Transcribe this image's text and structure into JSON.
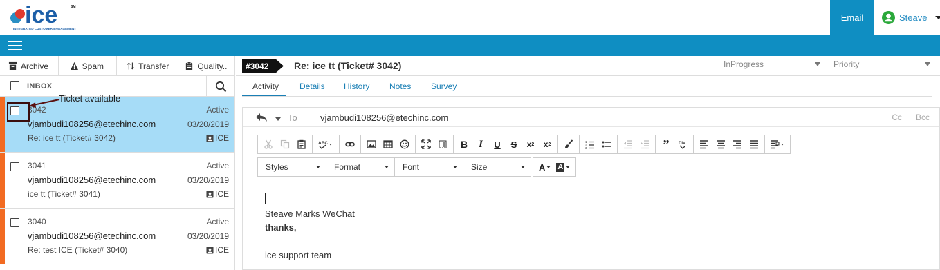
{
  "header": {
    "logo_text": "ice",
    "logo_sm": "SM",
    "logo_tagline": "INTEGRATED CUSTOMER ENGAGEMENT",
    "email_tab": "Email",
    "user_name": "Steave"
  },
  "colors": {
    "brand_blue": "#0f8ec2",
    "selected_row": "#a6dcf7",
    "priority_stripe": "#f26b22"
  },
  "actions": [
    {
      "label": "Archive",
      "icon": "archive-icon"
    },
    {
      "label": "Spam",
      "icon": "warning-icon"
    },
    {
      "label": "Transfer",
      "icon": "transfer-icon"
    },
    {
      "label": "Quality..",
      "icon": "clipboard-icon"
    }
  ],
  "inbox": {
    "label": "INBOX"
  },
  "tickets": [
    {
      "id": "3042",
      "status": "Active",
      "email": "vjambudi108256@etechinc.com",
      "date": "03/20/2019",
      "subject": "Re: ice tt (Ticket# 3042)",
      "source": "ICE"
    },
    {
      "id": "3041",
      "status": "Active",
      "email": "vjambudi108256@etechinc.com",
      "date": "03/20/2019",
      "subject": "ice tt (Ticket# 3041)",
      "source": "ICE"
    },
    {
      "id": "3040",
      "status": "Active",
      "email": "vjambudi108256@etechinc.com",
      "date": "03/20/2019",
      "subject": "Re: test ICE (Ticket# 3040)",
      "source": "ICE"
    }
  ],
  "annotation": {
    "text": "Ticket available"
  },
  "detail": {
    "badge": "#3042",
    "title": "Re: ice tt (Ticket# 3042)",
    "status_value": "InProgress",
    "priority_placeholder": "Priority",
    "tabs": [
      "Activity",
      "Details",
      "History",
      "Notes",
      "Survey"
    ],
    "to_label": "To",
    "to_value": "vjambudi108256@etechinc.com",
    "cc_label": "Cc",
    "bcc_label": "Bcc",
    "dropdowns": [
      "Styles",
      "Format",
      "Font",
      "Size"
    ],
    "body_lines": [
      "Steave Marks WeChat",
      "thanks,",
      "",
      "ice support team"
    ]
  }
}
